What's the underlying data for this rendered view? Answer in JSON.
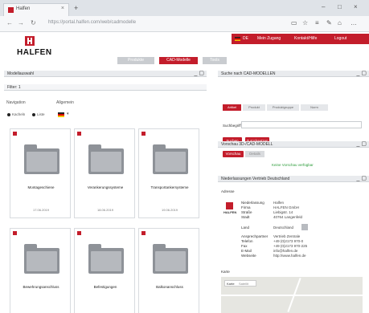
{
  "browser": {
    "tab_title": "Halfen",
    "tab_close": "×",
    "new_tab": "+",
    "url": "https://portal.halfen.com/web/cadmodelle",
    "window_controls": [
      "–",
      "□",
      "×"
    ],
    "toolbar_icons": [
      "reading-view-icon",
      "favorite-star-icon",
      "hub-icon",
      "pen-icon",
      "share-icon",
      "more-icon"
    ]
  },
  "header": {
    "logo_text": "HALFEN",
    "topbar": {
      "language": "DE",
      "login": "Mein Zugang",
      "links": [
        "Kontakt/Hilfe",
        "Logout"
      ]
    },
    "nav_tabs": [
      "Produkte",
      "CAD-Modelle",
      "Tools"
    ],
    "active_tab_index": 1
  },
  "left_panel": {
    "title": "Modellauswahl",
    "filter_label": "Filter: 1",
    "navigation_label": "Navigation",
    "general_label": "Allgemein",
    "format_options": [
      "Kacheln",
      "Liste"
    ],
    "flag_label": "DE",
    "cards": [
      {
        "name": "Montageschiene",
        "date": "17.06.2019"
      },
      {
        "name": "Verankerungssysteme",
        "date": "18.06.2019"
      },
      {
        "name": "Transportankersysteme",
        "date": "19.06.2019"
      },
      {
        "name": "Bewehrungsanschluss",
        "date": ""
      },
      {
        "name": "Befestigungen",
        "date": ""
      },
      {
        "name": "Balkonanschluss",
        "date": ""
      }
    ]
  },
  "right_search": {
    "title": "Suche nach CAD-MODELLEN",
    "tabs": [
      "Artikel",
      "Produkt",
      "Produktgruppe",
      "Norm"
    ],
    "field_label": "Suchbegriff",
    "field_placeholder": "",
    "buttons": [
      "Suchen",
      "Zurücksetzen"
    ]
  },
  "right_preview": {
    "title": "Vorschau 3D-/CAD-MODELL",
    "tabs": [
      "Vorschau",
      "Details"
    ],
    "message": "Keine Vorschau verfügbar"
  },
  "right_contact": {
    "title": "Niederlassungen Vertrieb Deutschland",
    "subtitle": "Adresse",
    "rows": [
      {
        "k": "Niederlassung",
        "v": "Halfen"
      },
      {
        "k": "Firma",
        "v": "HALFEN GmbH"
      },
      {
        "k": "Straße",
        "v": "Liebigstr. 14"
      },
      {
        "k": "Stadt",
        "v": "40764 Langenfeld"
      },
      {
        "k": "Land",
        "v": "Deutschland"
      },
      {
        "k": "Ansprechpartner",
        "v": "Vertrieb Zentrale"
      },
      {
        "k": "Telefon",
        "v": "+49 (0)2173 970-0"
      },
      {
        "k": "Fax",
        "v": "+49 (0)2173 970-225"
      },
      {
        "k": "E-Mail",
        "v": "info@halfen.de"
      },
      {
        "k": "Webseite",
        "v": "http://www.halfen.de"
      }
    ],
    "map_title": "Karte",
    "map_tabs": [
      "Karte",
      "Satellit"
    ]
  },
  "colors": {
    "brand_red": "#c31d2b",
    "panel_header": "#e9ebee",
    "success_green": "#2d9c3b"
  }
}
